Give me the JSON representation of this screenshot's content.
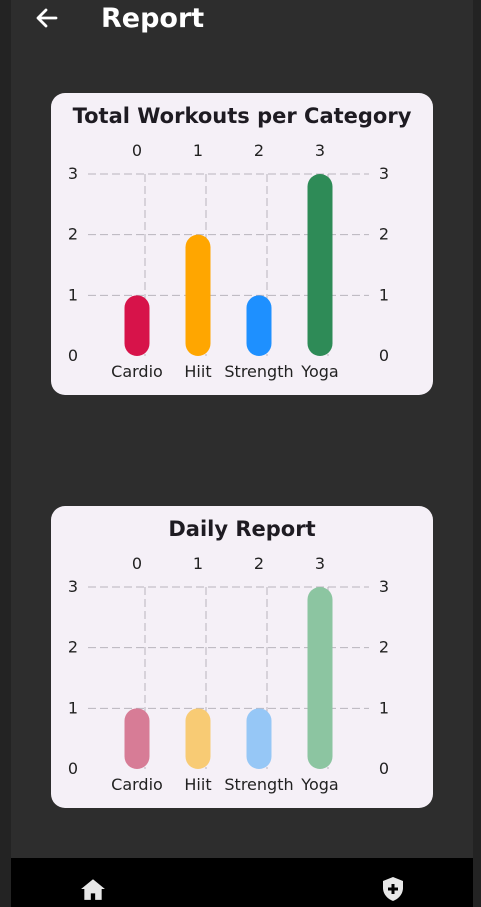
{
  "header": {
    "title": "Report",
    "back_icon": "arrow-left-icon"
  },
  "chart_data": [
    {
      "type": "bar",
      "title": "Total Workouts per Category",
      "categories": [
        "Cardio",
        "Hiit",
        "Strength",
        "Yoga"
      ],
      "top_labels": [
        "0",
        "1",
        "2",
        "3"
      ],
      "values": [
        1,
        2,
        1,
        3
      ],
      "colors": [
        "#d7134a",
        "#ffa600",
        "#1e90ff",
        "#2e8b57"
      ],
      "ylim": [
        0,
        3
      ],
      "yticks": [
        "0",
        "1",
        "2",
        "3"
      ],
      "grid": true
    },
    {
      "type": "bar",
      "title": "Daily Report",
      "categories": [
        "Cardio",
        "Hiit",
        "Strength",
        "Yoga"
      ],
      "top_labels": [
        "0",
        "1",
        "2",
        "3"
      ],
      "values": [
        1,
        1,
        1,
        3
      ],
      "colors": [
        "#d77c96",
        "#f8cb74",
        "#96c7f6",
        "#8cc5a1"
      ],
      "ylim": [
        0,
        3
      ],
      "yticks": [
        "0",
        "1",
        "2",
        "3"
      ],
      "grid": true
    }
  ],
  "bottom_nav": {
    "home_icon": "home-icon",
    "shield_icon": "shield-plus-icon"
  }
}
